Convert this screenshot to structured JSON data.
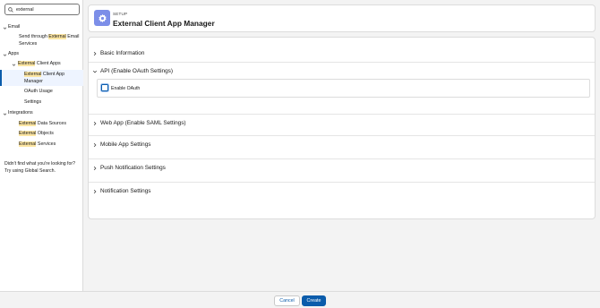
{
  "search": {
    "value": "external"
  },
  "tree": {
    "email_label": "Email",
    "send_through_pre": "Send through ",
    "send_through_hl": "External",
    "send_through_post": " Email",
    "send_through_line2": "Services",
    "apps_label": "Apps",
    "eca_hl": "External",
    "eca_post": " Client Apps",
    "ecam_hl": "External",
    "ecam_post": " Client App",
    "ecam_line2": "Manager",
    "oauth_usage": "OAuth Usage",
    "settings": "Settings",
    "integrations_label": "Integrations",
    "eds_hl": "External",
    "eds_post": " Data Sources",
    "eo_hl": "External",
    "eo_post": " Objects",
    "es_hl": "External",
    "es_post": " Services"
  },
  "help": {
    "line1": "Didn't find what you're looking for?",
    "line2": "Try using Global Search."
  },
  "header": {
    "eyebrow": "SETUP",
    "title": "External Client App Manager",
    "icon": "gear-icon",
    "icon_bg": "#7c8ee8"
  },
  "sections": {
    "basic": "Basic Information",
    "api": "API (Enable OAuth Settings)",
    "enable_oauth": "Enable OAuth",
    "web_app": "Web App (Enable SAML Settings)",
    "mobile": "Mobile App Settings",
    "push": "Push Notification Settings",
    "notification": "Notification Settings"
  },
  "footer": {
    "cancel": "Cancel",
    "create": "Create"
  },
  "colors": {
    "brand_blue": "#0b5cab",
    "highlight": "#fde6a3"
  }
}
